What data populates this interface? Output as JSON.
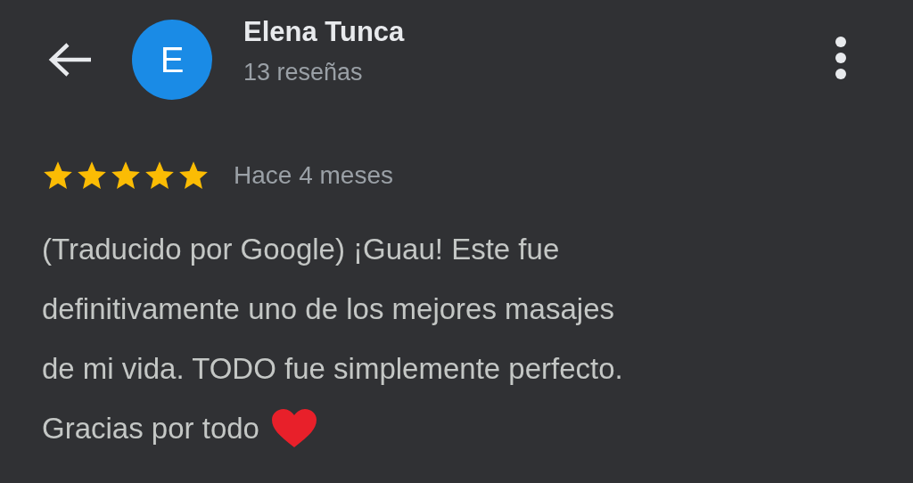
{
  "header": {
    "avatar_letter": "E",
    "name": "Elena Tunca",
    "subtitle": "13 reseñas"
  },
  "review": {
    "stars": 5,
    "time": "Hace 4 meses",
    "lines": [
      "(Traducido por Google) ¡Guau! Este fue",
      "definitivamente uno de los mejores masajes",
      "de mi vida. TODO fue simplemente perfecto.",
      "Gracias por todo"
    ]
  }
}
